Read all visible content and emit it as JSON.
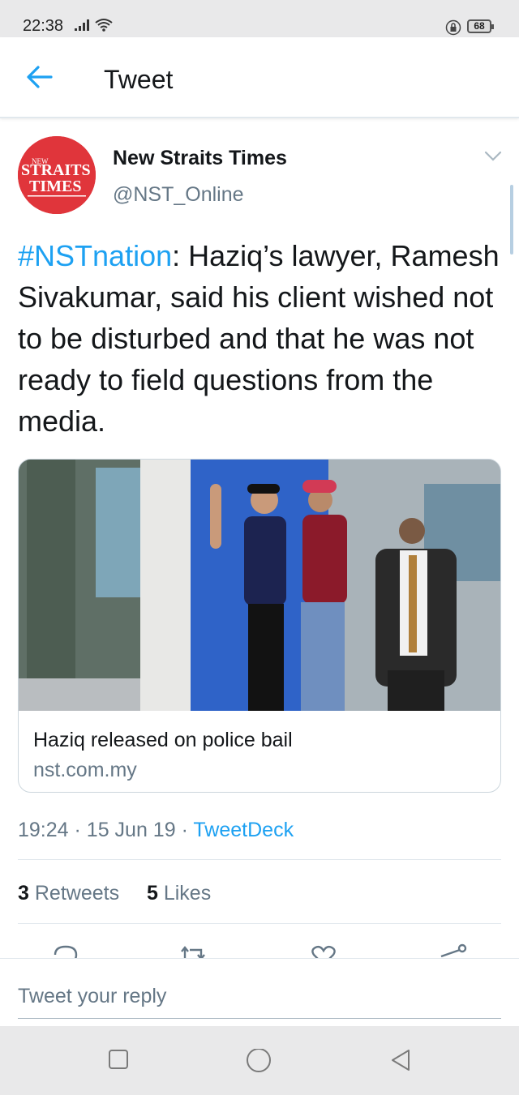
{
  "status_bar": {
    "time": "22:38",
    "battery": "68"
  },
  "header": {
    "title": "Tweet"
  },
  "tweet": {
    "author_name": "New Straits Times",
    "author_handle": "@NST_Online",
    "avatar_logo": "NEW STRAITS TIMES",
    "hashtag": "#NSTnation",
    "body": ": Haziq’s lawyer, Ramesh Sivakumar, said his client wished not to be disturbed and that he was not ready to field questions from the media.",
    "card": {
      "title": "Haziq released on police bail",
      "domain": "nst.com.my"
    },
    "time": "19:24",
    "date": "15 Jun 19",
    "source": "TweetDeck",
    "retweets_count": "3",
    "retweets_label": "Retweets",
    "likes_count": "5",
    "likes_label": "Likes"
  },
  "reply": {
    "placeholder": "Tweet your reply"
  },
  "colors": {
    "accent": "#1da1f2",
    "brand_red": "#e0353b",
    "muted": "#657786"
  },
  "icons": [
    "back-arrow-icon",
    "chevron-down-icon",
    "reply-icon",
    "retweet-icon",
    "like-icon",
    "share-icon",
    "nav-recents-icon",
    "nav-home-icon",
    "nav-back-icon"
  ]
}
